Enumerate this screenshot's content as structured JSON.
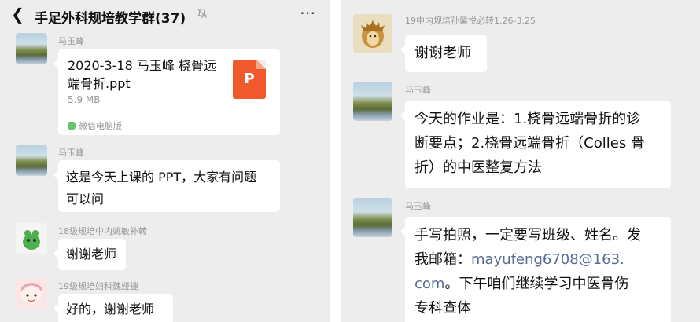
{
  "left_chat": {
    "title": "手足外科规培教学群(37)",
    "back_icon": "chevron-left-icon",
    "mute_icon": "bell-off-icon",
    "more_icon": "ellipsis-icon",
    "messages": [
      {
        "sender": "马玉峰",
        "type": "file",
        "file_name": "2020-3-18 马玉峰 桡骨远端骨折.ppt",
        "file_size": "5.9 MB",
        "file_letter": "P",
        "source": "微信电脑版",
        "file_icon_color": "#f0592c"
      },
      {
        "sender": "马玉峰",
        "text_line1": "这是今天上课的 PPT，大家有问题",
        "text_line2": "可以问"
      },
      {
        "sender": "18级规培中内姚敏补转",
        "text": "谢谢老师"
      },
      {
        "sender": "19级规培妇科魏娅捷",
        "text": "好的，谢谢老师"
      }
    ]
  },
  "right_chat": {
    "messages": [
      {
        "sender": "19中内规培孙馨悦必转1.26-3.25",
        "text": "谢谢老师"
      },
      {
        "sender": "马玉峰",
        "line1": "今天的作业是：1.桡骨远端骨折的诊",
        "line2": "断要点；2.桡骨远端骨折（Colles 骨",
        "line3": "折）的中医整复方法"
      },
      {
        "sender": "马玉峰",
        "line1": "手写拍照，一定要写班级、姓名。发",
        "line2_prefix": "我邮箱：",
        "email_part1": "mayufeng6708@163.",
        "email_part2": "com",
        "line3_suffix": "。下午咱们继续学习中医骨伤",
        "line4": "专科查体"
      }
    ]
  },
  "colors": {
    "chat_background": "#ededed",
    "bubble": "#ffffff",
    "link": "#576b95",
    "ppt_icon": "#f0592c"
  }
}
